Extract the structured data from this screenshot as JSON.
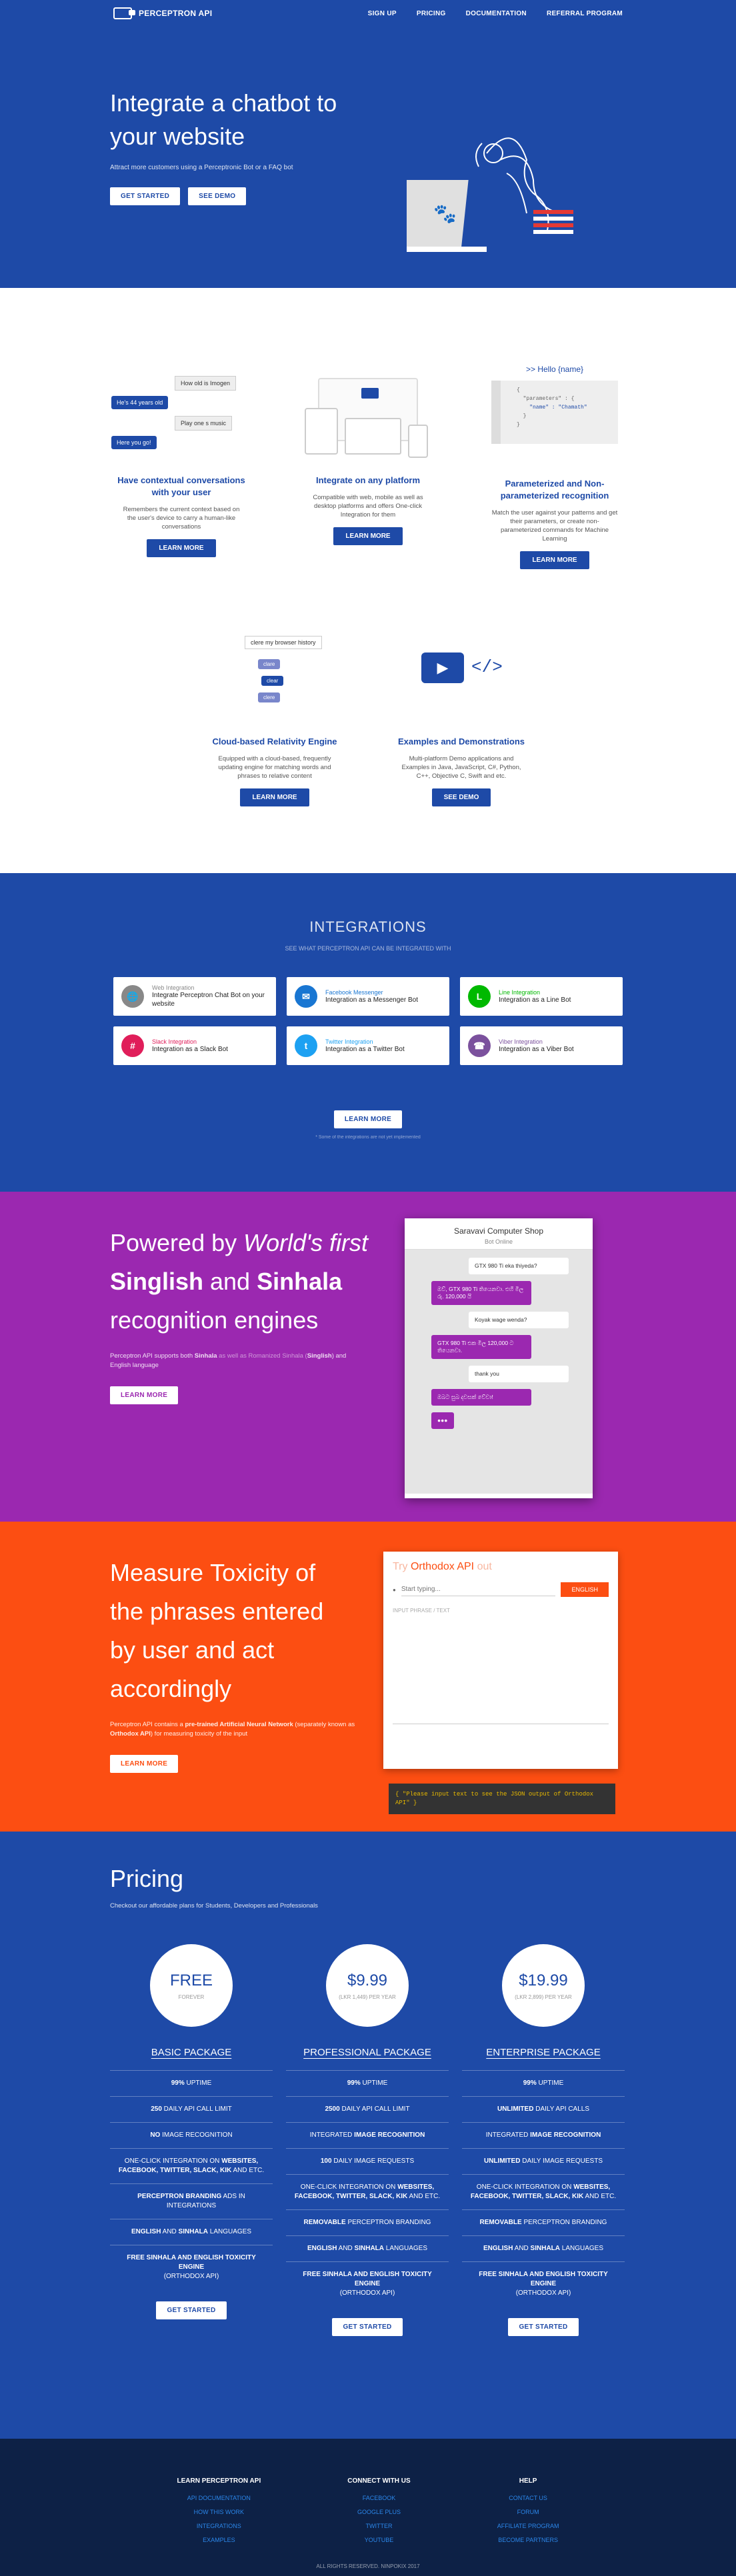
{
  "nav": {
    "brand": "PERCEPTRON API",
    "links": [
      "SIGN UP",
      "PRICING",
      "DOCUMENTATION",
      "REFERRAL PROGRAM"
    ]
  },
  "hero": {
    "title": "Integrate a chatbot to your website",
    "sub": "Attract more customers using a Perceptronic Bot or a FAQ bot",
    "btn1": "GET STARTED",
    "btn2": "SEE DEMO"
  },
  "features": [
    {
      "title": "Have contextual conversations with your user",
      "desc": "Remembers the current context based on the user's device to carry a human-like conversations",
      "btn": "LEARN MORE",
      "q1": "How old is Imogen",
      "a1": "He's 44 years old",
      "q2": "Play one s music",
      "a2": "Here you go!"
    },
    {
      "title": "Integrate on any platform",
      "desc": "Compatible with web, mobile as well as desktop platforms and offers One-click Integration for them",
      "btn": "LEARN MORE"
    },
    {
      "title": "Parameterized and Non-parameterized recognition",
      "desc": "Match the user against your patterns and get their parameters, or create non-parameterized commands for Machine Learning",
      "btn": "LEARN MORE",
      "code_head": ">> Hello {name}",
      "code": [
        "{",
        "  \"parameters\" : {",
        "    \"name\" : \"Chamath\"",
        "  }",
        "}"
      ]
    },
    {
      "title": "Cloud-based Relativity Engine",
      "desc": "Equipped with a cloud-based, frequently updating engine for matching words and phrases to relative content",
      "btn": "LEARN MORE",
      "tag1": "clere my browser history",
      "tag2": "clare",
      "tag3": "clear",
      "tag4": "clere"
    },
    {
      "title": "Examples and Demonstrations",
      "desc": "Multi-platform Demo applications and Examples in Java, JavaScript, C#, Python, C++, Objective C, Swift and etc.",
      "btn": "SEE DEMO"
    }
  ],
  "integrations": {
    "title": "INTEGRATIONS",
    "sub": "SEE WHAT PERCEPTRON API CAN BE INTEGRATED WITH",
    "more": "LEARN MORE",
    "note": "* Some of the integrations are not yet implemented",
    "items": [
      {
        "name": "Web Integration",
        "desc": "Integrate Perceptron Chat Bot on your website",
        "color": "#888888",
        "icon": "globe-icon",
        "glyph": "🌐"
      },
      {
        "name": "Facebook Messenger",
        "desc": "Integration as a Messenger Bot",
        "color": "#1976d2",
        "icon": "messenger-icon",
        "glyph": "✉"
      },
      {
        "name": "Line Integration",
        "desc": "Integration as a Line Bot",
        "color": "#00b900",
        "icon": "line-icon",
        "glyph": "L"
      },
      {
        "name": "Slack Integration",
        "desc": "Integration as a Slack Bot",
        "color": "#e01e5a",
        "icon": "slack-icon",
        "glyph": "#"
      },
      {
        "name": "Twitter Integration",
        "desc": "Integration as a Twitter Bot",
        "color": "#1da1f2",
        "icon": "twitter-icon",
        "glyph": "t"
      },
      {
        "name": "Viber Integration",
        "desc": "Integration as a Viber Bot",
        "color": "#7b519d",
        "icon": "viber-icon",
        "glyph": "☎"
      }
    ]
  },
  "singlish": {
    "pre": "Powered by ",
    "em": "World's first",
    "mid1": " ",
    "b1": "Singlish",
    "mid2": " and ",
    "b2": "Sinhala",
    "post": " recognition engines",
    "desc_pre": "Perceptron API supports both ",
    "desc_b1": "Sinhala",
    "desc_mid": " as well as Romanized Sinhala (",
    "desc_b2": "Singlish",
    "desc_post": ") and English language",
    "btn": "LEARN MORE",
    "phone": {
      "shop": "Saravavi Computer Shop",
      "status": "Bot Online",
      "m1": "GTX 980 Ti eka thiyeda?",
      "m2": "ඔව්, GTX 980 Ti තියෙනවා. එහි මිල රු. 120,000 යි",
      "m3": "Koyak wage wenda?",
      "m4": "GTX 980 Ti එක මිල 120,000 ට තියෙනවා.",
      "m5": "thank you",
      "m6": "ඔබට සුබ දවසක් වේවා!"
    }
  },
  "toxicity": {
    "t1": "Measure ",
    "tb": "Toxicity",
    "t2": " of the phrases entered by user and act accordingly",
    "desc_pre": "Perceptron API contains a ",
    "desc_b": "pre-trained Artificial Neural Network",
    "desc_mid": " (separately known as ",
    "desc_b2": "Orthodox API",
    "desc_post": ") for measuring toxicity of the input",
    "btn": "LEARN MORE",
    "try_pre": "Try ",
    "try_b": "Orthodox API",
    "try_post": " out",
    "placeholder": "Start typing...",
    "try_btn": "ENGLISH",
    "input_label": "INPUT PHRASE / TEXT",
    "code": "{ \"Please input text to see the JSON output of Orthodox API\" }"
  },
  "pricing": {
    "title": "Pricing",
    "sub": "Checkout our affordable plans for Students, Developers and Professionals",
    "plans": [
      {
        "price": "FREE",
        "per": "FOREVER",
        "name": "BASIC PACKAGE",
        "feats": [
          "<b>99%</b> UPTIME",
          "<b>250</b> DAILY API CALL LIMIT",
          "<b>NO</b> IMAGE RECOGNITION",
          "ONE-CLICK INTEGRATION ON <b>WEBSITES, FACEBOOK, TWITTER, SLACK, KIK</b> AND ETC.",
          "<b>PERCEPTRON BRANDING</b> ADS IN INTEGRATIONS",
          "<b>ENGLISH</b> AND <b>SINHALA</b> LANGUAGES",
          "<b>FREE SINHALA AND ENGLISH TOXICITY ENGINE</b><br>(ORTHODOX API)"
        ],
        "btn": "GET STARTED"
      },
      {
        "price": "$9.99",
        "per": "(LKR 1,449) PER YEAR",
        "name": "PROFESSIONAL PACKAGE",
        "feats": [
          "<b>99%</b> UPTIME",
          "<b>2500</b> DAILY API CALL LIMIT",
          "INTEGRATED <b>IMAGE RECOGNITION</b>",
          "<b>100</b> DAILY IMAGE REQUESTS",
          "ONE-CLICK INTEGRATION ON <b>WEBSITES, FACEBOOK, TWITTER, SLACK, KIK</b> AND ETC.",
          "<b>REMOVABLE</b> PERCEPTRON BRANDING",
          "<b>ENGLISH</b> AND <b>SINHALA</b> LANGUAGES",
          "<b>FREE SINHALA AND ENGLISH TOXICITY ENGINE</b><br>(ORTHODOX API)"
        ],
        "btn": "GET STARTED"
      },
      {
        "price": "$19.99",
        "per": "(LKR 2,899) PER YEAR",
        "name": "ENTERPRISE PACKAGE",
        "feats": [
          "<b>99%</b> UPTIME",
          "<b>UNLIMITED</b> DAILY API CALLS",
          "INTEGRATED <b>IMAGE RECOGNITION</b>",
          "<b>UNLIMITED</b> DAILY IMAGE REQUESTS",
          "ONE-CLICK INTEGRATION ON <b>WEBSITES, FACEBOOK, TWITTER, SLACK, KIK</b> AND ETC.",
          "<b>REMOVABLE</b> PERCEPTRON BRANDING",
          "<b>ENGLISH</b> AND <b>SINHALA</b> LANGUAGES",
          "<b>FREE SINHALA AND ENGLISH TOXICITY ENGINE</b><br>(ORTHODOX API)"
        ],
        "btn": "GET STARTED"
      }
    ]
  },
  "footer": {
    "cols": [
      {
        "title": "LEARN PERCEPTRON API",
        "links": [
          "API DOCUMENTATION",
          "HOW THIS WORK",
          "INTEGRATIONS",
          "EXAMPLES"
        ]
      },
      {
        "title": "CONNECT WITH US",
        "links": [
          "FACEBOOK",
          "GOOGLE PLUS",
          "TWITTER",
          "YOUTUBE"
        ]
      },
      {
        "title": "HELP",
        "links": [
          "CONTACT US",
          "FORUM",
          "AFFILIATE PROGRAM",
          "BECOME PARTNERS"
        ]
      }
    ],
    "copy": "ALL RIGHTS RESERVED. NINPOKIX 2017"
  }
}
